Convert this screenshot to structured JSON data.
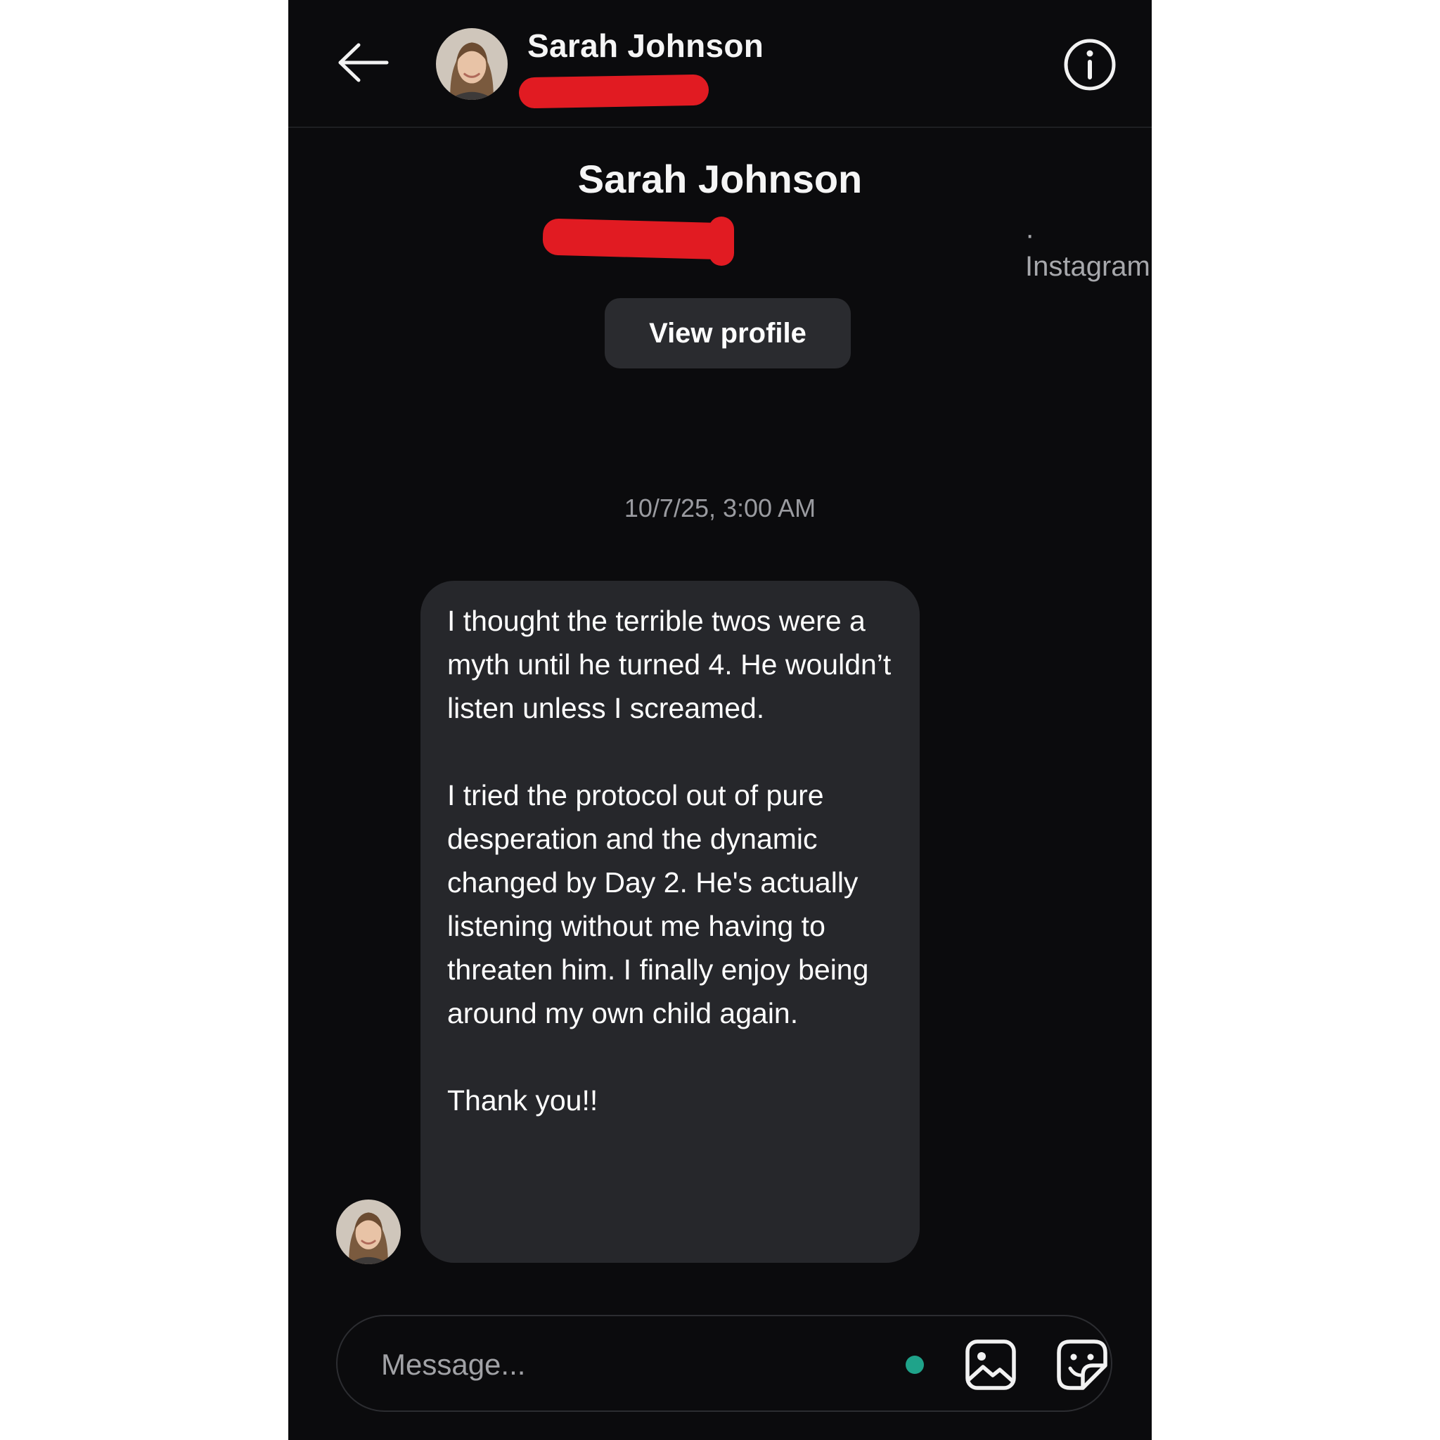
{
  "header": {
    "name": "Sarah Johnson",
    "icons": {
      "back": "arrow-left-icon",
      "info": "info-circle-icon"
    }
  },
  "profile": {
    "name": "Sarah Johnson",
    "platform": "· Instagram",
    "view_profile_label": "View profile"
  },
  "conversation": {
    "timestamp": "10/7/25, 3:00 AM",
    "messages": [
      {
        "from": "Sarah Johnson",
        "paragraphs": [
          "I thought the terrible twos were a myth until he turned 4. He wouldn’t listen unless I screamed.",
          "I tried the protocol out of pure desperation and the dynamic changed by Day 2. He's actually listening without me having to threaten him. I finally enjoy being around my own child again.",
          "Thank you!!"
        ]
      }
    ]
  },
  "composer": {
    "placeholder": "Message...",
    "icons": {
      "gallery": "image-icon",
      "sticker": "sticker-icon"
    }
  },
  "colors": {
    "background": "#0b0b0d",
    "bubble": "#26272b",
    "redaction": "#e11b22",
    "online": "#1fa38a"
  }
}
